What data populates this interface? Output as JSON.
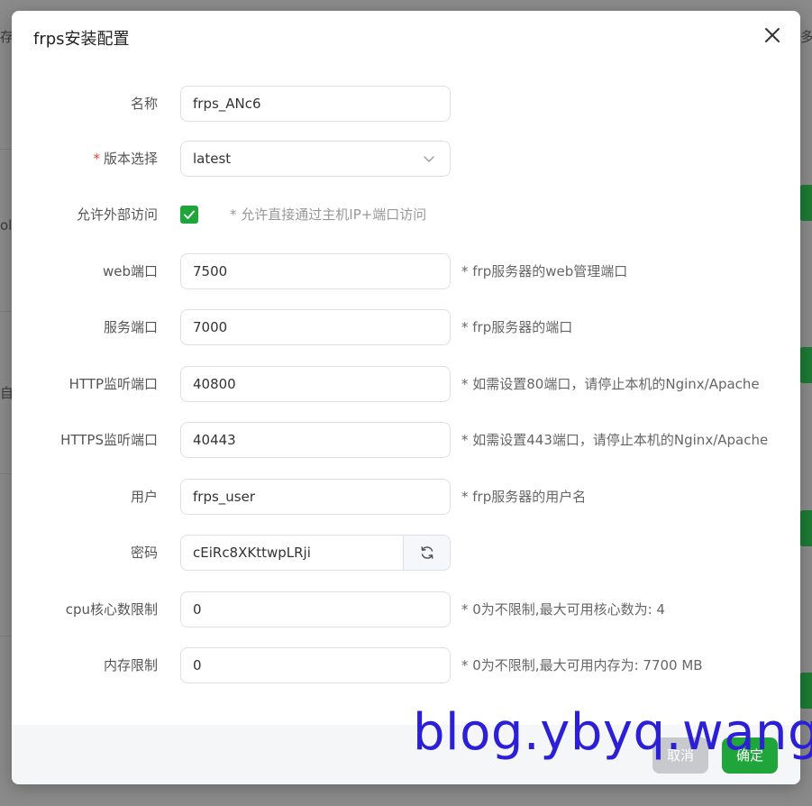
{
  "background": {
    "left_fragments": [
      "存",
      "olla",
      "自"
    ],
    "right_fragment": "多"
  },
  "dialog": {
    "title": "frps安装配置",
    "close_icon": "close-icon"
  },
  "form": {
    "name": {
      "label": "名称",
      "value": "frps_ANc6"
    },
    "version": {
      "required_mark": "*",
      "label": "版本选择",
      "value": "latest",
      "icon": "chevron-down-icon"
    },
    "external_access": {
      "label": "允许外部访问",
      "checked": true,
      "hint": "* 允许直接通过主机IP+端口访问"
    },
    "web_port": {
      "label": "web端口",
      "value": "7500",
      "hint": "* frp服务器的web管理端口"
    },
    "service_port": {
      "label": "服务端口",
      "value": "7000",
      "hint": "* frp服务器的端口"
    },
    "http_port": {
      "label": "HTTP监听端口",
      "value": "40800",
      "hint": "* 如需设置80端口，请停止本机的Nginx/Apache"
    },
    "https_port": {
      "label": "HTTPS监听端口",
      "value": "40443",
      "hint": "* 如需设置443端口，请停止本机的Nginx/Apache"
    },
    "user": {
      "label": "用户",
      "value": "frps_user",
      "hint": "* frp服务器的用户名"
    },
    "password": {
      "label": "密码",
      "value": "cEiRc8XKttwpLRji",
      "icon": "refresh-icon"
    },
    "cpu_limit": {
      "label": "cpu核心数限制",
      "value": "0",
      "hint": "* 0为不限制,最大可用核心数为: 4"
    },
    "mem_limit": {
      "label": "内存限制",
      "value": "0",
      "hint": "* 0为不限制,最大可用内存为: 7700 MB"
    }
  },
  "footer": {
    "cancel_label": "取消",
    "confirm_label": "确定"
  },
  "watermark": "blog.ybyq.wang",
  "colors": {
    "accent": "#20a53a",
    "required": "#e04343",
    "watermark": "#2c20d6"
  }
}
